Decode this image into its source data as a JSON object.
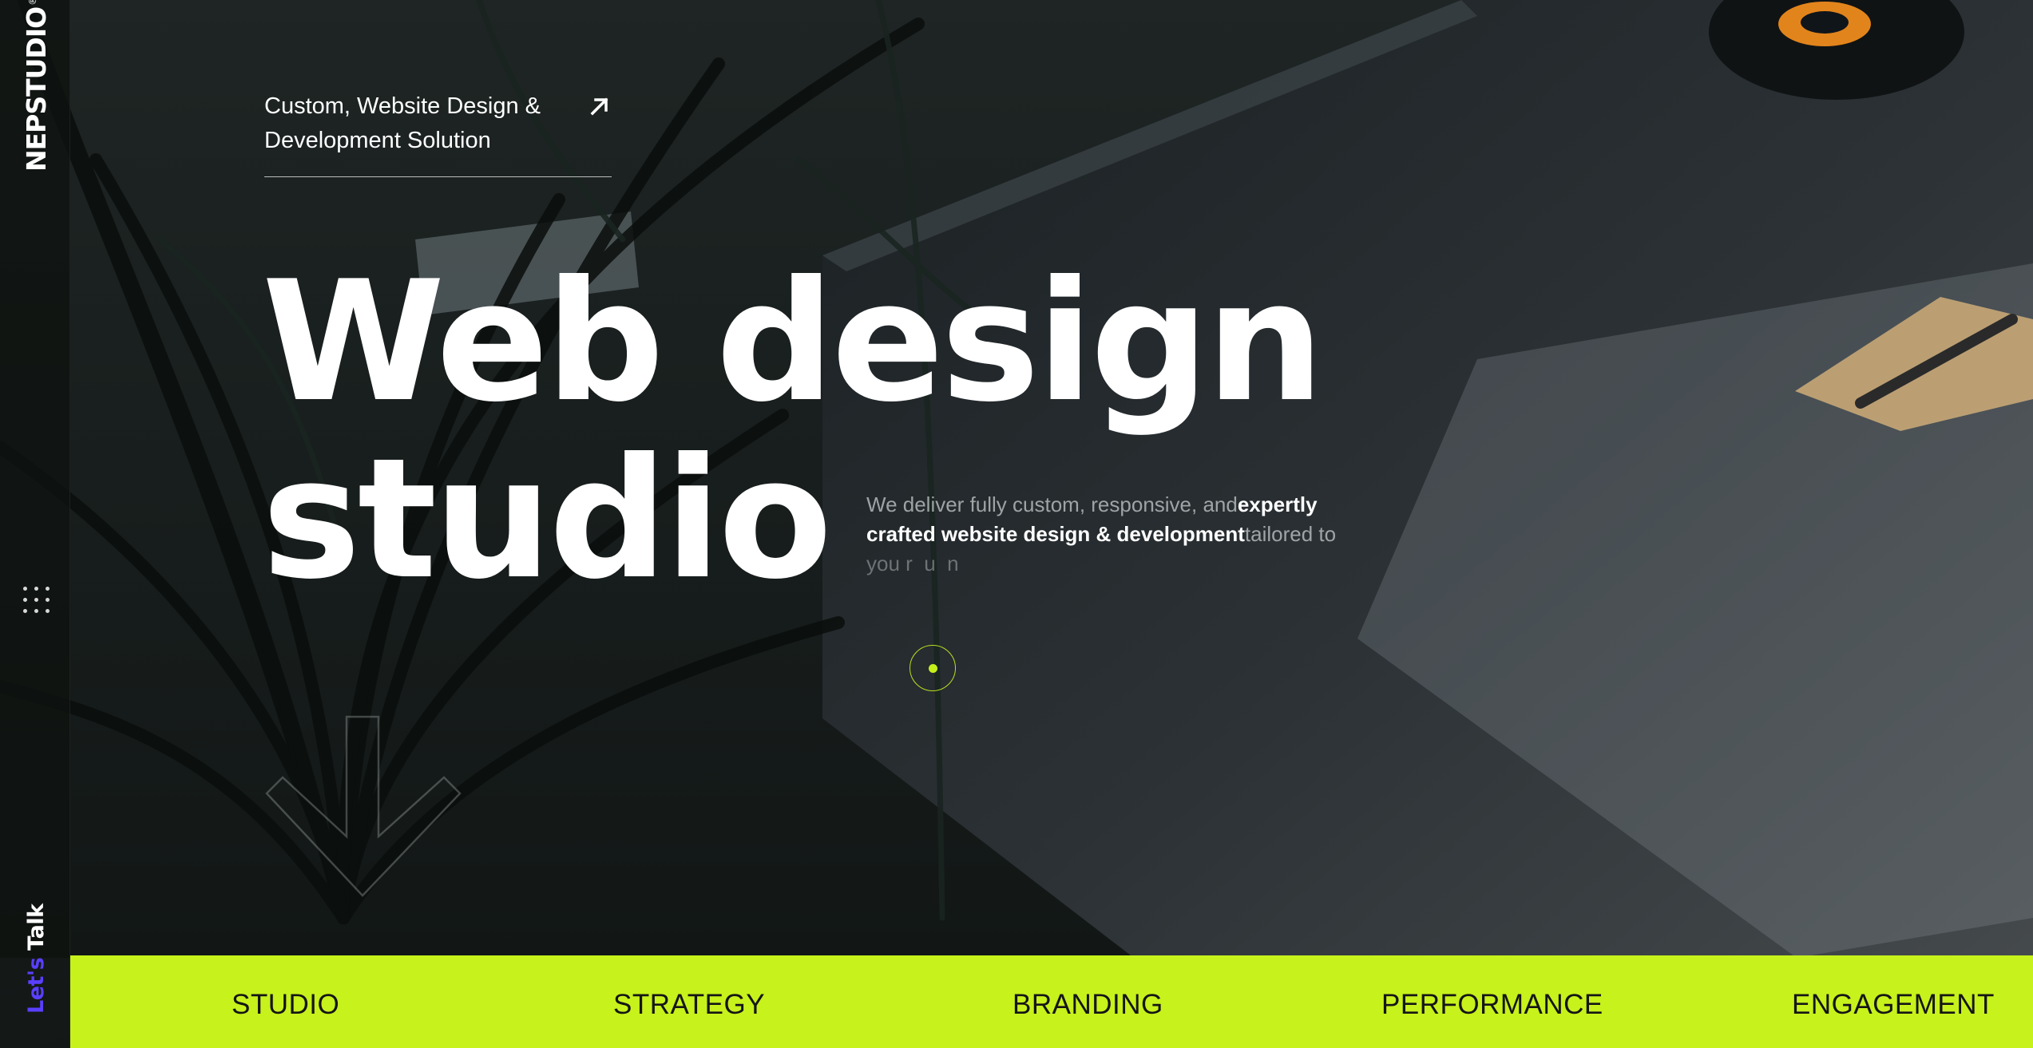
{
  "brand": {
    "logo_text": "NEPSTUDIO",
    "logo_mark": "®",
    "accent_color": "#c7f21c",
    "cta_color": "#5b3fff"
  },
  "rail": {
    "menu_icon": "grid-dots-icon",
    "cta_part1": "Let's",
    "cta_part2": " Talk"
  },
  "top_link": {
    "text": "Custom, Website Design & Development Solution",
    "icon": "arrow-up-right-icon"
  },
  "hero": {
    "line1": "Web design",
    "line2": "studio"
  },
  "blurb": {
    "plain1": "We deliver fully custom, responsive, and",
    "strong": "expertly crafted website design & development",
    "plain2": "tailored to",
    "fade": "you r  u  n"
  },
  "scroll": {
    "icon": "arrow-down-icon"
  },
  "band": {
    "items": [
      "STUDIO",
      "STRATEGY",
      "BRANDING",
      "PERFORMANCE",
      "ENGAGEMENT"
    ]
  }
}
